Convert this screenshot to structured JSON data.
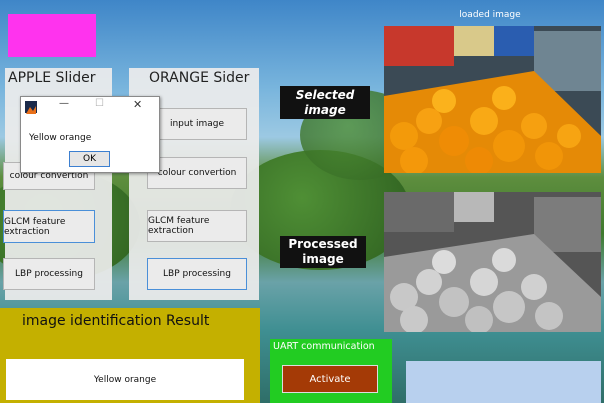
{
  "loaded_image_title": "loaded image",
  "apple_panel": {
    "title": "APPLE Slider",
    "buttons": [
      "colour convertion",
      "GLCM feature extraction",
      "LBP processing"
    ]
  },
  "orange_panel": {
    "title": "ORANGE Sider",
    "buttons": [
      "input image",
      "colour convertion",
      "GLCM feature extraction",
      "LBP processing"
    ]
  },
  "selected_label": "Selected image",
  "processed_label": "Processed image",
  "result": {
    "title": "image identification Result",
    "value": "Yellow orange"
  },
  "uart": {
    "title": "UART communication",
    "button": "Activate"
  },
  "dialog": {
    "message": "Yellow orange",
    "ok": "OK",
    "minimize": "—",
    "maximize": "☐",
    "close": "✕"
  },
  "colors": {
    "magenta": "#ff33ee",
    "result_bg": "#c4b000",
    "uart_bg": "#22cc22",
    "activate_bg": "#a43a06",
    "light_blue": "#b8d0ee"
  }
}
